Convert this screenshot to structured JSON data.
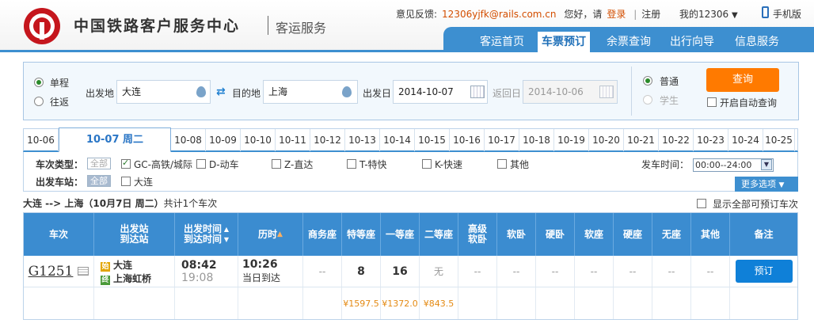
{
  "header": {
    "site_title": "中国铁路客户服务中心",
    "sub_title": "客运服务",
    "feedback_label": "意见反馈:",
    "feedback_email": "12306yjfk@rails.com.cn",
    "greeting": "您好，请",
    "login": "登录",
    "separator": "|",
    "register": "注册",
    "my12306": "我的12306",
    "mobile": "手机版"
  },
  "nav": [
    "客运首页",
    "车票预订",
    "余票查询",
    "出行向导",
    "信息服务"
  ],
  "search": {
    "one_way": "单程",
    "round_trip": "往返",
    "from_label": "出发地",
    "from_value": "大连",
    "to_label": "目的地",
    "to_value": "上海",
    "depart_label": "出发日",
    "depart_value": "2014-10-07",
    "return_label": "返回日",
    "return_value": "2014-10-06",
    "normal": "普通",
    "student": "学生",
    "query_btn": "查询",
    "auto_query": "开启自动查询"
  },
  "dates": [
    {
      "label": "10-06"
    },
    {
      "label": "10-07 周二",
      "active": true
    },
    {
      "label": "10-08"
    },
    {
      "label": "10-09"
    },
    {
      "label": "10-10"
    },
    {
      "label": "10-11"
    },
    {
      "label": "10-12"
    },
    {
      "label": "10-13"
    },
    {
      "label": "10-14"
    },
    {
      "label": "10-15"
    },
    {
      "label": "10-16"
    },
    {
      "label": "10-17"
    },
    {
      "label": "10-18"
    },
    {
      "label": "10-19"
    },
    {
      "label": "10-20"
    },
    {
      "label": "10-21"
    },
    {
      "label": "10-22"
    },
    {
      "label": "10-23"
    },
    {
      "label": "10-24"
    },
    {
      "label": "10-25"
    }
  ],
  "filter": {
    "type_label": "车次类型：",
    "all": "全部",
    "types": [
      "GC-高铁/城际",
      "D-动车",
      "Z-直达",
      "T-特快",
      "K-快速",
      "其他"
    ],
    "station_label": "出发车站：",
    "station_all": "全部",
    "station": "大连",
    "time_label": "发车时间：",
    "time_value": "00:00--24:00",
    "more": "更多选项"
  },
  "summary": {
    "route": "大连 --> 上海（10月7日  周二）",
    "count": "共计1个车次",
    "show_all": "显示全部可预订车次"
  },
  "table": {
    "headers": [
      "车次",
      "出发站\n到达站",
      "出发时间\n到达时间",
      "历时",
      "商务座",
      "特等座",
      "一等座",
      "二等座",
      "高级\n软卧",
      "软卧",
      "硬卧",
      "软座",
      "硬座",
      "无座",
      "其他",
      "备注"
    ],
    "train": {
      "no": "G1251",
      "from_badge": "始",
      "from": "大连",
      "to_badge": "终",
      "to": "上海虹桥",
      "depart": "08:42",
      "arrive": "19:08",
      "duration": "10:26",
      "arrival_day": "当日到达",
      "seats": [
        "--",
        "8",
        "16",
        "无",
        "--",
        "--",
        "--",
        "--",
        "--",
        "--",
        "--"
      ],
      "book": "预订"
    },
    "prices": [
      "¥1597.5",
      "¥1372.0",
      "¥843.5"
    ]
  }
}
